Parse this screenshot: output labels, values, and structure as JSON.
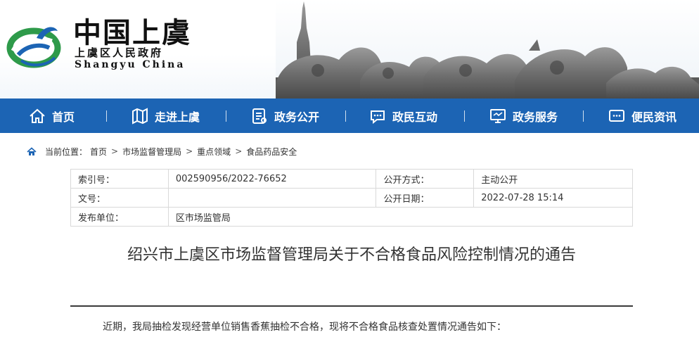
{
  "header": {
    "site_title": "中国上虞",
    "subtitle_cn": "上虞区人民政府",
    "subtitle_en": "Shangyu China"
  },
  "nav": {
    "items": [
      {
        "label": "首页",
        "icon": "home-icon"
      },
      {
        "label": "走进上虞",
        "icon": "map-icon"
      },
      {
        "label": "政务公开",
        "icon": "document-icon"
      },
      {
        "label": "政民互动",
        "icon": "chat-icon"
      },
      {
        "label": "政务服务",
        "icon": "monitor-icon"
      },
      {
        "label": "便民资讯",
        "icon": "message-icon"
      }
    ]
  },
  "breadcrumb": {
    "prefix": "当前位置：",
    "items": [
      "首页",
      "市场监督管理局",
      "重点领域",
      "食品药品安全"
    ],
    "separator": ">"
  },
  "meta": {
    "index_label": "索引号：",
    "index_value": "002590956/2022-76652",
    "method_label": "公开方式：",
    "method_value": "主动公开",
    "doc_no_label": "文号：",
    "doc_no_value": "",
    "date_label": "公开日期：",
    "date_value": "2022-07-28 15:14",
    "publisher_label": "发布单位：",
    "publisher_value": "区市场监管局"
  },
  "article": {
    "title": "绍兴市上虞区市场监督管理局关于不合格食品风险控制情况的通告",
    "first_paragraph": "近期，我局抽检发现经营单位销售香蕉抽检不合格，现将不合格食品核查处置情况通告如下："
  },
  "colors": {
    "nav_bg": "#1c64b4",
    "logo_green": "#2e9a4a",
    "logo_blue": "#1c64b4"
  }
}
